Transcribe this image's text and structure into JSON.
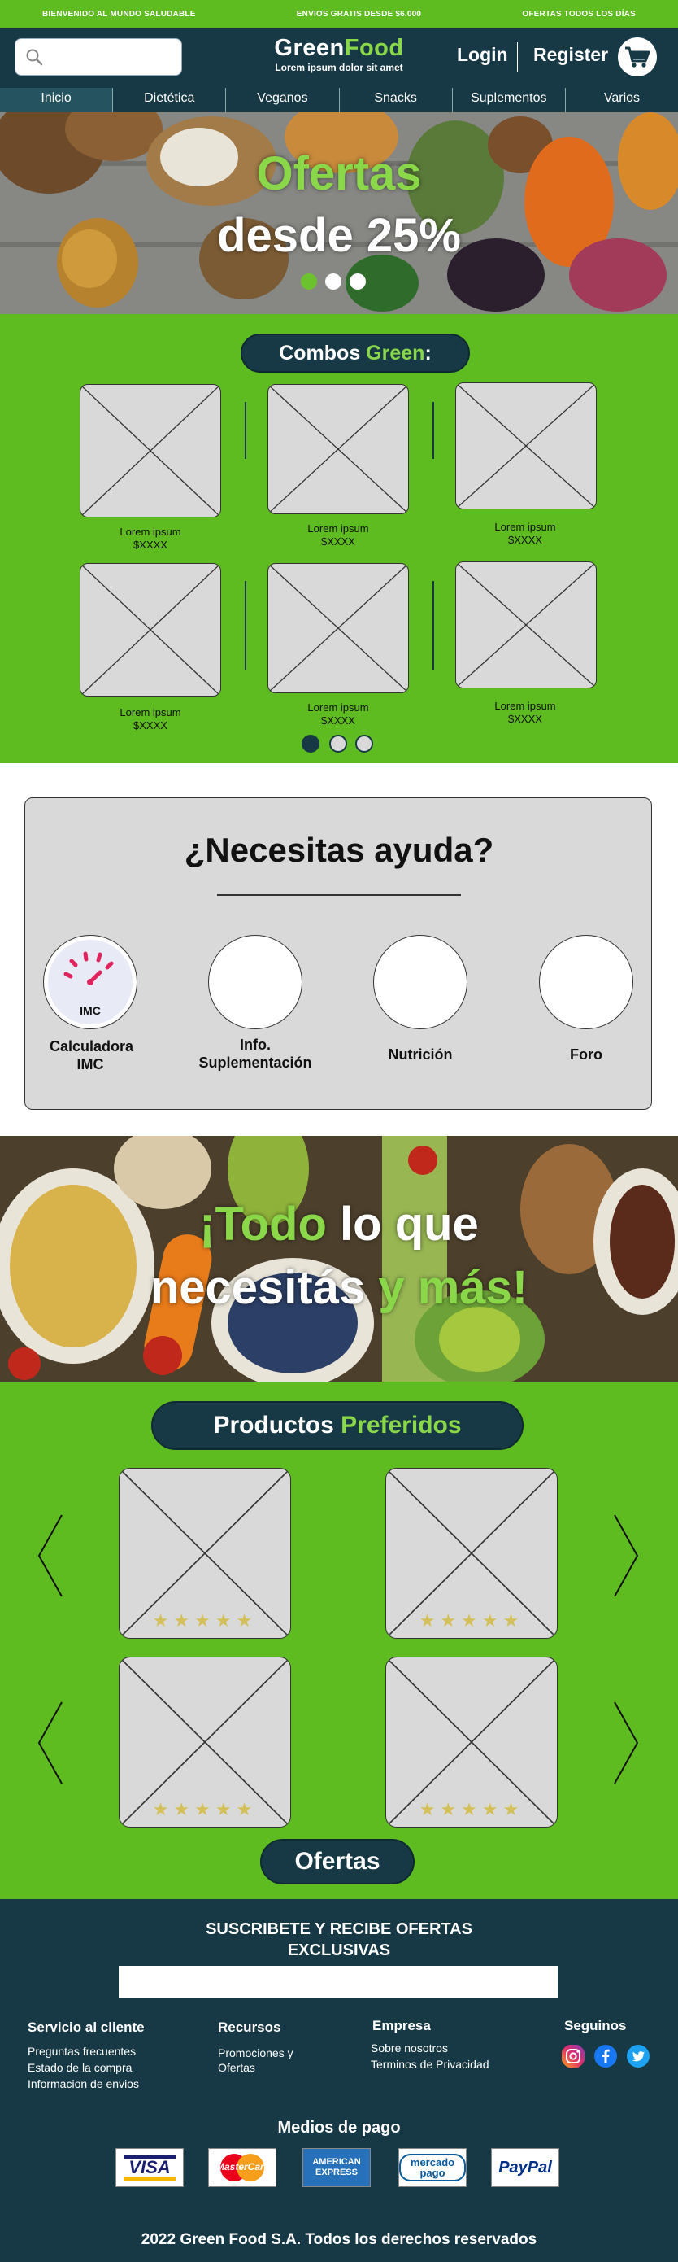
{
  "topbar": {
    "left": "BIENVENIDO AL MUNDO SALUDABLE",
    "center": "ENVIOS GRATIS DESDE $6.000",
    "right": "OFERTAS TODOS LOS DÍAS"
  },
  "header": {
    "brand_a": "Green",
    "brand_b": "Food",
    "tagline": "Lorem ipsum dolor sit amet",
    "search_placeholder": "",
    "login": "Login",
    "register": "Register"
  },
  "nav": {
    "items": [
      "Inicio",
      "Dietética",
      "Veganos",
      "Snacks",
      "Suplementos",
      "Varios"
    ],
    "active_index": 0
  },
  "hero": {
    "line1": "Ofertas",
    "line2": "desde 25%",
    "slides": 3,
    "active_slide": 0
  },
  "combos": {
    "title_a": "Combos ",
    "title_b": "Green",
    "title_c": ":",
    "items": [
      {
        "name": "Lorem ipsum",
        "price": "$XXXX"
      },
      {
        "name": "Lorem ipsum",
        "price": "$XXXX"
      },
      {
        "name": "Lorem ipsum",
        "price": "$XXXX"
      },
      {
        "name": "Lorem ipsum",
        "price": "$XXXX"
      },
      {
        "name": "Lorem ipsum",
        "price": "$XXXX"
      },
      {
        "name": "Lorem ipsum",
        "price": "$XXXX"
      }
    ],
    "pages": 3,
    "active_page": 0
  },
  "help": {
    "title": "¿Necesitas ayuda?",
    "imc_badge": "IMC",
    "items": [
      {
        "label": "Calculadora IMC"
      },
      {
        "label": "Info. Suplementación"
      },
      {
        "label": "Nutrición"
      },
      {
        "label": "Foro"
      }
    ]
  },
  "banner": {
    "line1_a": "¡Todo",
    "line1_b": " lo que",
    "line2_a": "necesitás ",
    "line2_b": "y más!"
  },
  "products": {
    "title_a": "Productos ",
    "title_b": "Preferidos",
    "rating_stars": "★★★★★",
    "offers_button": "Ofertas"
  },
  "footer": {
    "subscribe_line1": "SUSCRIBETE Y RECIBE OFERTAS",
    "subscribe_line2": "EXCLUSIVAS",
    "subscribe_placeholder": "",
    "columns": [
      {
        "title": "Servicio al cliente",
        "items": [
          "Preguntas frecuentes",
          "Estado de la compra",
          "Informacion de envios"
        ]
      },
      {
        "title": "Recursos",
        "items": [
          "Promociones y",
          "Ofertas"
        ]
      },
      {
        "title": "Empresa",
        "items": [
          "Sobre nosotros",
          "Terminos de Privacidad"
        ]
      },
      {
        "title": "Seguinos",
        "items": []
      }
    ],
    "social": [
      "instagram-icon",
      "facebook-icon",
      "twitter-icon"
    ],
    "payments_title": "Medios de pago",
    "payments": [
      "VISA",
      "MasterCard",
      "AMERICAN EXPRESS",
      "mercado pago",
      "PayPal"
    ],
    "copyright": "2022 Green Food S.A. Todos los derechos reservados"
  },
  "colors": {
    "primary_dark": "#173945",
    "accent_green": "#5ebb20",
    "light_green": "#8ad84a",
    "placeholder_gray": "#d9d9d9",
    "star_gold": "#d4c05a"
  }
}
